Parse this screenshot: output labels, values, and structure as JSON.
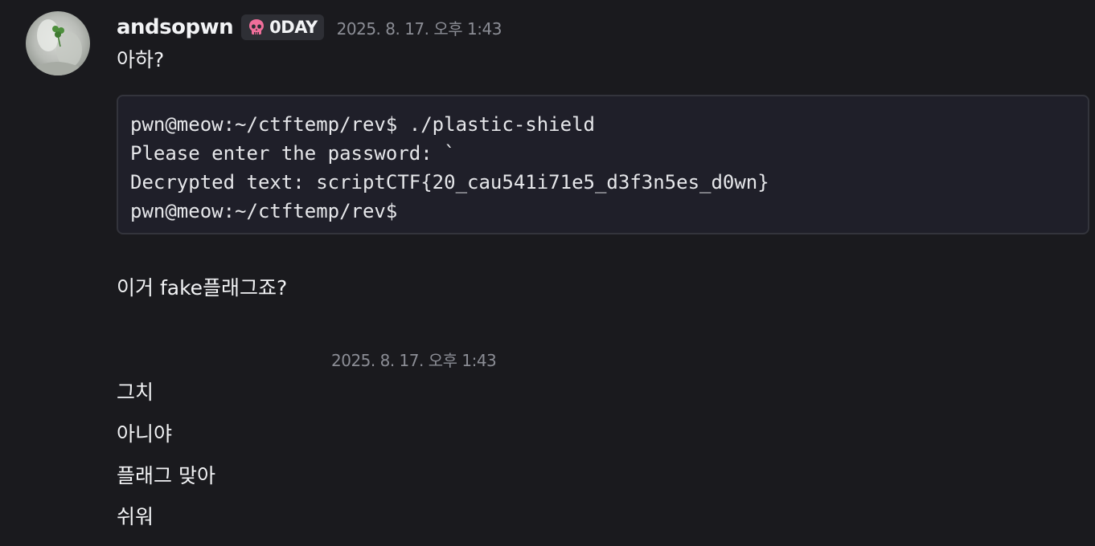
{
  "message_group_1": {
    "author": "andsopwn",
    "role_tag": "0DAY",
    "role_icon": "skull-icon",
    "timestamp": "2025. 8. 17. 오후 1:43",
    "text_1": "아하?",
    "code_lines": [
      "pwn@meow:~/ctftemp/rev$ ./plastic-shield",
      "Please enter the password: `",
      "Decrypted text: scriptCTF{20_cau541i71e5_d3f3n5es_d0wn}",
      "pwn@meow:~/ctftemp/rev$"
    ],
    "text_2": "이거 fake플래그죠?"
  },
  "message_group_2": {
    "timestamp": "2025. 8. 17. 오후 1:43",
    "lines": [
      "그치",
      "아니야",
      "플래그 맞아",
      "쉬워"
    ]
  },
  "colors": {
    "background": "#1a1a1e",
    "code_background": "#1f1f29",
    "timestamp": "#8b8d95",
    "tag_background": "#2e2f35",
    "skull": "#f06e9a"
  }
}
